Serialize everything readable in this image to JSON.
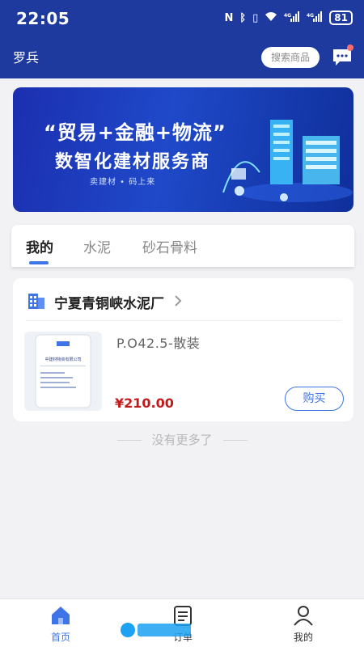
{
  "status": {
    "time": "22:05",
    "icons": [
      "nfc-icon",
      "bluetooth-icon",
      "vibrate-icon",
      "wifi-icon",
      "signal-4g-icon",
      "signal-4g-icon"
    ],
    "battery": "81"
  },
  "header": {
    "username": "罗兵",
    "search_label": "搜索商品",
    "message_icon": "message-icon"
  },
  "banner": {
    "title1": "“贸易+金融+物流”",
    "title2": "数智化建材服务商",
    "subtitle": "卖建材 • 码上来"
  },
  "tabs": [
    {
      "label": "我的",
      "active": true
    },
    {
      "label": "水泥",
      "active": false
    },
    {
      "label": "砂石骨料",
      "active": false
    }
  ],
  "store": {
    "name": "宁夏青铜峡水泥厂",
    "product": {
      "name": "P.O42.5-散装",
      "price": "¥210.00",
      "buy_label": "购买",
      "bag_text": "中建材物资有限公司"
    }
  },
  "list_end": "没有更多了",
  "nav": [
    {
      "label": "首页",
      "icon": "home-icon",
      "active": true
    },
    {
      "label": "订单",
      "icon": "order-icon",
      "active": false
    },
    {
      "label": "我的",
      "icon": "user-icon",
      "active": false
    }
  ],
  "colors": {
    "header": "#1e3a9e",
    "accent": "#3f74e6",
    "price": "#c21b1b"
  }
}
